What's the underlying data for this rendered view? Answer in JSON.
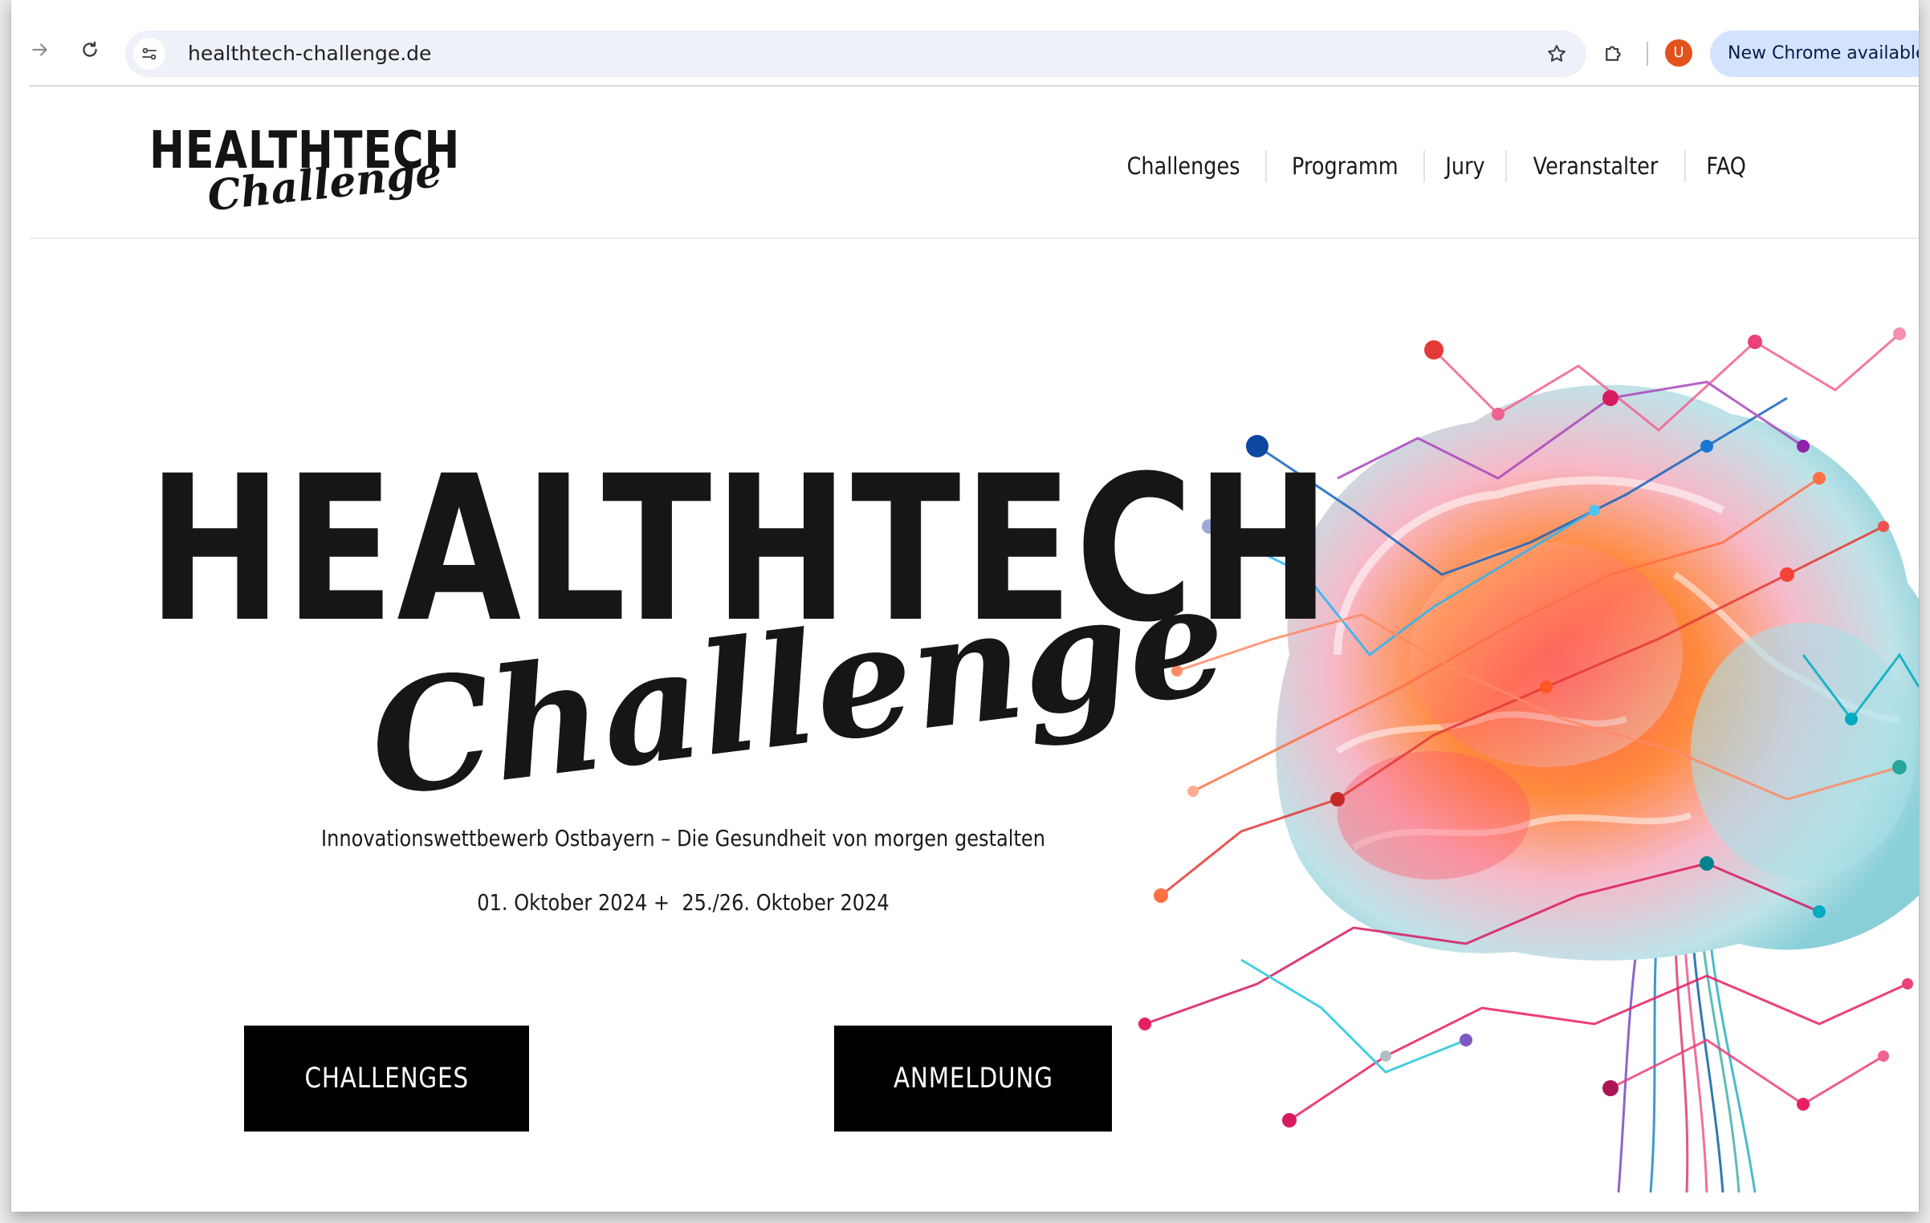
{
  "browser": {
    "url": "healthtech-challenge.de",
    "profile_initial": "U",
    "update_label": "New Chrome available"
  },
  "site": {
    "logo": {
      "top": "HEALTHTECH",
      "script": "Challenge"
    },
    "nav": [
      "Challenges",
      "Programm",
      "Jury",
      "Veranstalter",
      "FAQ"
    ]
  },
  "hero": {
    "title": "HEALTHTECH",
    "script": "Challenge",
    "subtitle": "Innovationswettbewerb Ostbayern – Die Gesundheit von morgen gestalten",
    "dates": "01. Oktober 2024 +  25./26. Oktober 2024",
    "buttons": {
      "challenges": "CHALLENGES",
      "anmeldung": "ANMELDUNG"
    }
  },
  "colors": {
    "accent_dark": "#000000",
    "avatar": "#e2531b",
    "update_pill": "#d3e3fd"
  }
}
